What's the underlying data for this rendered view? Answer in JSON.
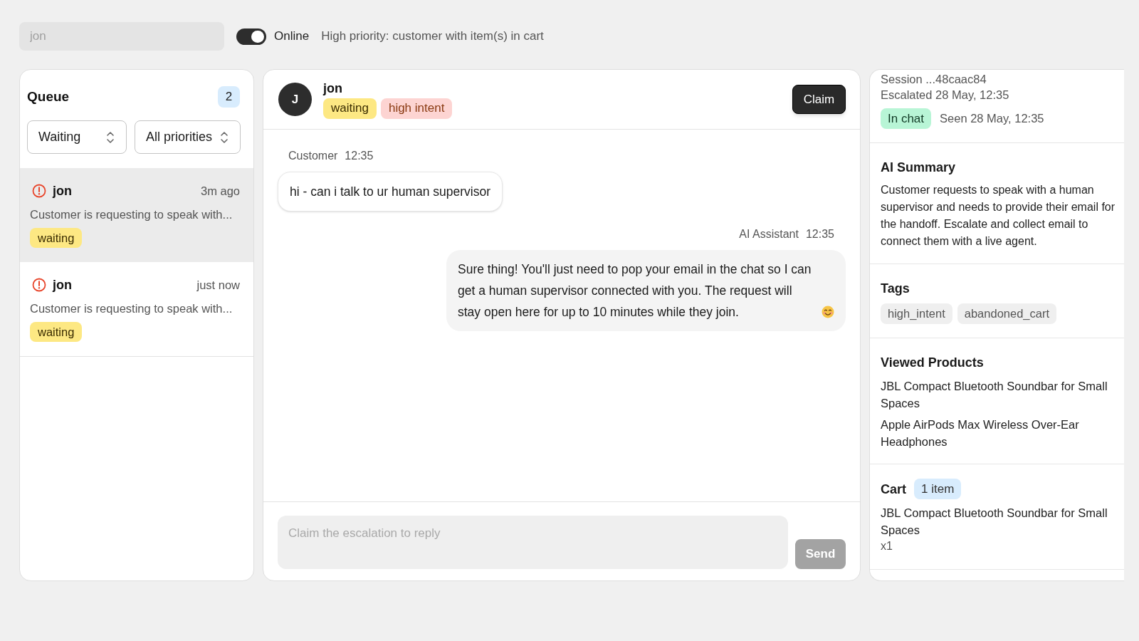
{
  "toolbar": {
    "search": {
      "value": "jon"
    },
    "online_toggle": {
      "on": true,
      "label": "Online"
    },
    "notice": "High priority: customer with item(s) in cart"
  },
  "queue": {
    "title": "Queue",
    "count": "2",
    "filters": [
      {
        "value": "Waiting"
      },
      {
        "value": "All priorities"
      }
    ],
    "items": [
      {
        "name": "jon",
        "time": "3m ago",
        "preview": "Customer is requesting to speak with...",
        "status": "waiting",
        "selected": true
      },
      {
        "name": "jon",
        "time": "just now",
        "preview": "Customer is requesting to speak with...",
        "status": "waiting",
        "selected": false
      }
    ]
  },
  "conversation": {
    "avatar": "J",
    "name": "jon",
    "badges": [
      {
        "label": "waiting",
        "kind": "status"
      },
      {
        "label": "high intent",
        "kind": "intent"
      }
    ],
    "claim_button": "Claim",
    "messages": [
      {
        "kind": "customer",
        "sender": "Customer",
        "time": "12:35",
        "text": "hi - can i talk to ur human supervisor",
        "ends_with_emoji": false
      },
      {
        "kind": "assistant",
        "sender": "AI Assistant",
        "time": "12:35",
        "text": "Sure thing! You'll just need to pop your email in the chat so I can get a human supervisor connected with you. The request will stay open here for up to 10 minutes while they join.",
        "ends_with_emoji": true
      }
    ],
    "composer": {
      "placeholder": "Claim the escalation to reply",
      "send_button": "Send",
      "disabled": true
    }
  },
  "details": {
    "session": "Session ...48caac84",
    "escalated": "Escalated 28 May, 12:35",
    "presence": "In chat",
    "seen": "Seen 28 May, 12:35",
    "summary": {
      "title": "AI Summary",
      "text": "Customer requests to speak with a human supervisor and needs to provide their email for the handoff. Escalate and collect email to connect them with a live agent."
    },
    "tags": {
      "title": "Tags",
      "items": [
        "high_intent",
        "abandoned_cart"
      ]
    },
    "viewed_products": {
      "title": "Viewed Products",
      "items": [
        "JBL Compact Bluetooth Soundbar for Small Spaces",
        "Apple AirPods Max Wireless Over-Ear Headphones"
      ]
    },
    "cart": {
      "title": "Cart",
      "count": "1 item",
      "items": [
        {
          "name": "JBL Compact Bluetooth Soundbar for Small Spaces",
          "quantity": "x1"
        }
      ]
    }
  }
}
